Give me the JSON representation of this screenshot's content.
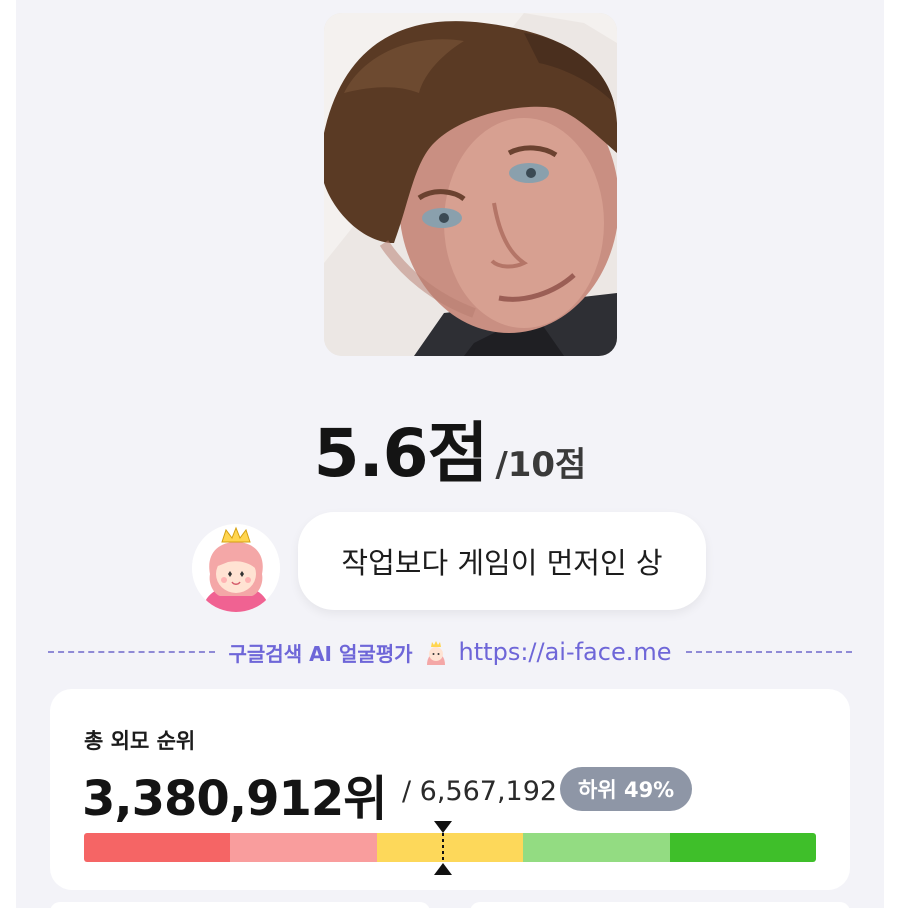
{
  "score": {
    "value": "5.6점",
    "max": "/10점"
  },
  "comment": {
    "text": "작업보다 게임이 먼저인 상"
  },
  "divider": {
    "title": "구글검색 AI 얼굴평가",
    "url": "https://ai-face.me"
  },
  "rank": {
    "label": "총 외모 순위",
    "value": "3,380,912위",
    "total": "/ 6,567,192",
    "badge": "하위 49%",
    "percentile": 0.49,
    "segment_colors": [
      "#f56565",
      "#f99d9d",
      "#fdd85a",
      "#93dc82",
      "#3fbf2a"
    ]
  },
  "colors": {
    "accent": "#6e66d8",
    "badge": "#8e96a6",
    "panel_bg": "#f3f3f8"
  },
  "icons": {
    "avatar": "princess-avatar-icon",
    "divider_face": "princess-face-icon",
    "marker": "rank-marker-icon"
  }
}
